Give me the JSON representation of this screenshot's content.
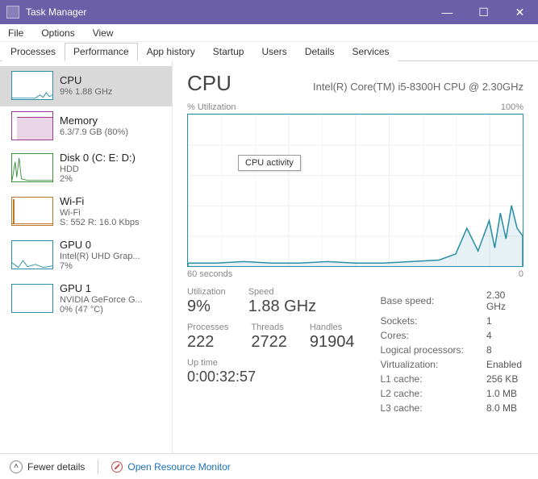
{
  "window": {
    "title": "Task Manager"
  },
  "menu": [
    "File",
    "Options",
    "View"
  ],
  "tabs": [
    "Processes",
    "Performance",
    "App history",
    "Startup",
    "Users",
    "Details",
    "Services"
  ],
  "active_tab": 1,
  "sidebar": [
    {
      "name": "CPU",
      "sub": "9% 1.88 GHz",
      "color": "#2b8fa8"
    },
    {
      "name": "Memory",
      "sub": "6.3/7.9 GB (80%)",
      "color": "#9b3d91"
    },
    {
      "name": "Disk 0 (C: E: D:)",
      "sub": "HDD",
      "sub2": "2%",
      "color": "#3f8f3f"
    },
    {
      "name": "Wi-Fi",
      "sub": "Wi-Fi",
      "sub2": "S: 552 R: 16.0 Kbps",
      "color": "#b9772b"
    },
    {
      "name": "GPU 0",
      "sub": "Intel(R) UHD Grap...",
      "sub2": "7%",
      "color": "#2b8fa8"
    },
    {
      "name": "GPU 1",
      "sub": "NVIDIA GeForce G...",
      "sub2": "0% (47 °C)",
      "color": "#2b8fa8"
    }
  ],
  "main": {
    "title": "CPU",
    "subtitle": "Intel(R) Core(TM) i5-8300H CPU @ 2.30GHz",
    "chart_top_left": "% Utilization",
    "chart_top_right": "100%",
    "chart_bottom_left": "60 seconds",
    "chart_bottom_right": "0",
    "tooltip": "CPU activity",
    "stats_left": [
      [
        {
          "label": "Utilization",
          "value": "9%"
        },
        {
          "label": "Speed",
          "value": "1.88 GHz"
        }
      ],
      [
        {
          "label": "Processes",
          "value": "222"
        },
        {
          "label": "Threads",
          "value": "2722"
        },
        {
          "label": "Handles",
          "value": "91904"
        }
      ]
    ],
    "uptime_label": "Up time",
    "uptime_value": "0:00:32:57",
    "stats_right": [
      [
        "Base speed:",
        "2.30 GHz"
      ],
      [
        "Sockets:",
        "1"
      ],
      [
        "Cores:",
        "4"
      ],
      [
        "Logical processors:",
        "8"
      ],
      [
        "Virtualization:",
        "Enabled"
      ],
      [
        "L1 cache:",
        "256 KB"
      ],
      [
        "L2 cache:",
        "1.0 MB"
      ],
      [
        "L3 cache:",
        "8.0 MB"
      ]
    ]
  },
  "footer": {
    "fewer": "Fewer details",
    "orm": "Open Resource Monitor"
  },
  "chart_data": {
    "type": "line",
    "title": "CPU % Utilization",
    "xlabel": "seconds ago",
    "ylabel": "% Utilization",
    "ylim": [
      0,
      100
    ],
    "xrange": [
      60,
      0
    ],
    "series": [
      {
        "name": "CPU",
        "color": "#2b8fa8",
        "x": [
          60,
          55,
          50,
          45,
          40,
          35,
          30,
          25,
          20,
          15,
          12,
          10,
          8,
          6,
          5,
          4,
          3,
          2,
          1,
          0
        ],
        "y": [
          2,
          2,
          3,
          2,
          2,
          3,
          2,
          2,
          3,
          4,
          8,
          25,
          10,
          30,
          12,
          35,
          18,
          40,
          25,
          20
        ]
      }
    ]
  }
}
